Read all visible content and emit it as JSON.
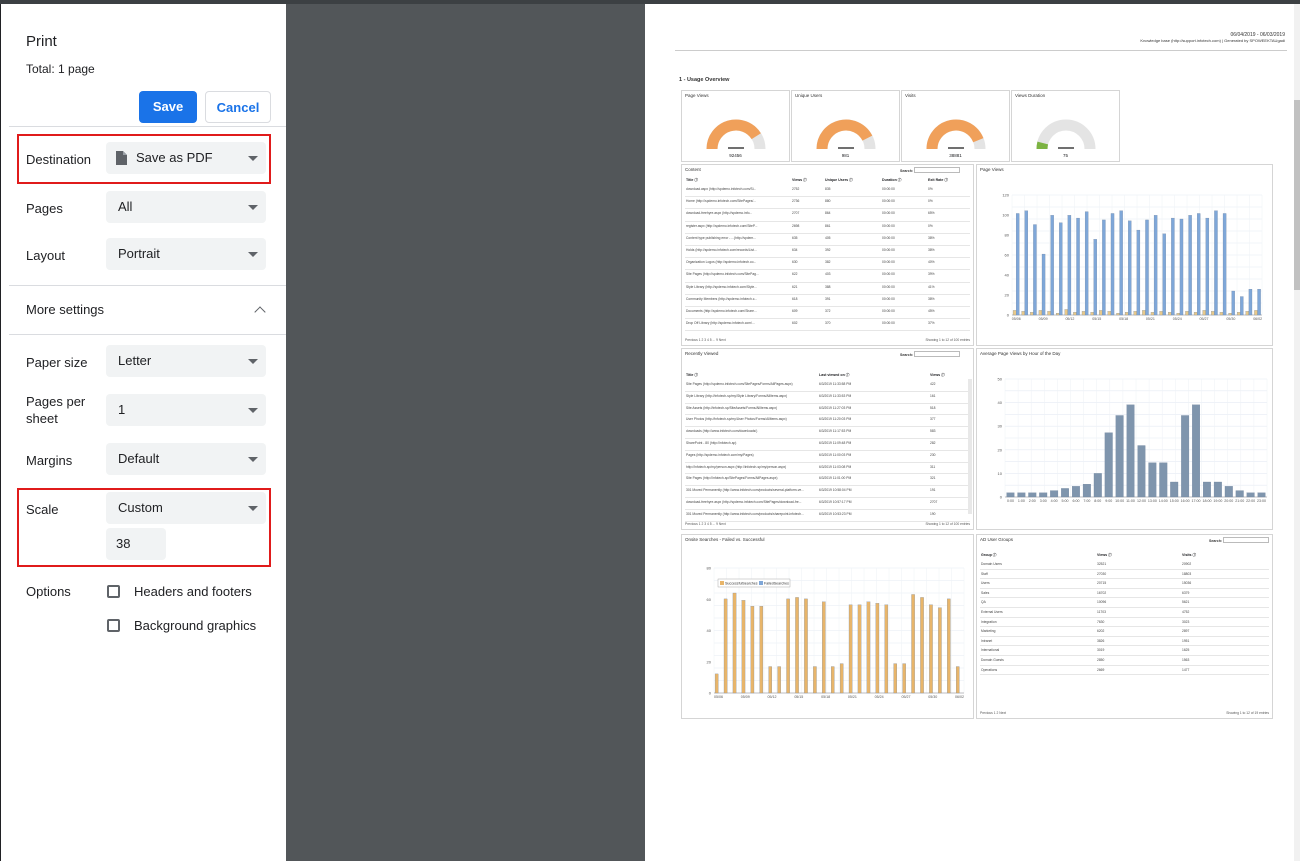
{
  "dialog": {
    "title": "Print",
    "total": "Total: 1 page",
    "save_label": "Save",
    "cancel_label": "Cancel"
  },
  "settings": {
    "destination": {
      "label": "Destination",
      "value": "Save as PDF"
    },
    "pages": {
      "label": "Pages",
      "value": "All"
    },
    "layout": {
      "label": "Layout",
      "value": "Portrait"
    },
    "more_settings": "More settings",
    "paper_size": {
      "label": "Paper size",
      "value": "Letter"
    },
    "pages_per_sheet": {
      "label": "Pages per sheet",
      "value": "1"
    },
    "margins": {
      "label": "Margins",
      "value": "Default"
    },
    "scale": {
      "label": "Scale",
      "value": "Custom",
      "custom_value": "38"
    },
    "options": {
      "label": "Options",
      "headers_footers": {
        "label": "Headers and footers",
        "checked": false
      },
      "background_graphics": {
        "label": "Background graphics",
        "checked": false
      }
    }
  },
  "preview": {
    "header_right_1": "06/04/2019 - 06/03/2019",
    "header_right_2": "Knowledge base (http://support.infotech.com) | Generated by SPOWEEKTAUgadi",
    "section_title": "1 - Usage Overview",
    "gauges": [
      {
        "title": "Page Views",
        "value": "92456",
        "level": 0.82
      },
      {
        "title": "Unique Users",
        "value": "981",
        "level": 0.85
      },
      {
        "title": "Visits",
        "value": "38881",
        "level": 0.88
      },
      {
        "title": "Views Duration",
        "value": "75",
        "level": 0.08
      }
    ],
    "content_panel": {
      "title": "Content",
      "search_label": "Search:",
      "columns": [
        "Title",
        "Views",
        "Unique Users",
        "Duration",
        "Exit Rate"
      ],
      "rows": [
        [
          "download.aspx (http://spdemo.infotech.com/Si...",
          "2752",
          "835",
          "00:00:00",
          "0%"
        ],
        [
          "Home (http://spdemo.infotech.com/SitePages/...",
          "2736",
          "880",
          "00:00:00",
          "0%"
        ],
        [
          "download-freehyre.aspx (http://spdemo.info...",
          "2707",
          "864",
          "00:00:00",
          "65%"
        ],
        [
          "register.aspx (http://spdemo.infotech.com/SiteP...",
          "2698",
          "861",
          "00:00:00",
          "0%"
        ],
        [
          "Content type publishing error - ...(http://spdem...",
          "635",
          "405",
          "00:00:00",
          "38%"
        ],
        [
          "Holds (http://spdemo.infotech.com/records/List...",
          "634",
          "392",
          "00:00:00",
          "38%"
        ],
        [
          "Organization Logos (http://spdemo.infotech.co...",
          "630",
          "382",
          "00:00:00",
          "40%"
        ],
        [
          "Site Pages (http://spdemo.infotech.com/SitePag...",
          "622",
          "403",
          "00:00:00",
          "39%"
        ],
        [
          "Style Library (http://spdemo.infotech.com/Style...",
          "621",
          "388",
          "00:00:00",
          "41%"
        ],
        [
          "Community Members (http://spdemo.infotech.c...",
          "618",
          "391",
          "00:00:00",
          "38%"
        ],
        [
          "Documents (http://spdemo.infotech.com/Share...",
          "609",
          "372",
          "00:00:00",
          "45%"
        ],
        [
          "Drop Off Library (http://spdemo.infotech.com/...",
          "602",
          "370",
          "00:00:00",
          "37%"
        ]
      ],
      "pager": "Previous  1  2  3  4  5 ... 9  Next",
      "showing": "Showing 1 to 12 of 100 entries"
    },
    "pageviews_chart": {
      "title": "Page Views",
      "yticks": [
        "120",
        "100",
        "80",
        "60",
        "40",
        "20",
        "0"
      ],
      "xticks": [
        "05/06",
        "05/09",
        "05/12",
        "05/15",
        "05/18",
        "05/21",
        "05/24",
        "05/27",
        "05/30",
        "06/02"
      ]
    },
    "recent_panel": {
      "title": "Recently Viewed",
      "search_label": "Search:",
      "columns": [
        "Title",
        "Last viewed on",
        "Views"
      ],
      "rows": [
        [
          "Site Pages (http://spdemo.infotech.com/SitePages/Forms/AllPages.aspx)",
          "6/3/2019 11:33:58 PM",
          "422"
        ],
        [
          "Style Library (http://infotech-sp/my/Style Library/Forms/AllItems.aspx)",
          "6/3/2019 11:33:53 PM",
          "161"
        ],
        [
          "Site Assets (http://infotech-sp/SiteAssets/Forms/AllItems.aspx)",
          "6/3/2019 11:27:03 PM",
          "518"
        ],
        [
          "User Photos (http://infotech-sp/my/User Photos/Forms/AllItems.aspx)",
          "6/3/2019 11:20:03 PM",
          "377"
        ],
        [
          "downloads (http://www.infotech.com/downloads/)",
          "6/3/2019 11:17:53 PM",
          "583"
        ],
        [
          "SharePoint - 80 (http://infotech-sp)",
          "6/3/2019 11:09:48 PM",
          "282"
        ],
        [
          "Pages (http://spdemo.infotech.com/my/Pages)",
          "6/3/2019 11:00:03 PM",
          "230"
        ],
        [
          "http://infotech-sp/my/person.aspx (http://infotech-sp/my/person.aspx)",
          "6/3/2019 11:03:08 PM",
          "311"
        ],
        [
          "Site Pages (http://infotech-sp/SitePages/Forms/AllPages.aspx)",
          "6/3/2019 11:01:00 PM",
          "321"
        ],
        [
          "301 Moved Permanently (http://www.infotech.com/products/several-platform-ve...",
          "6/3/2019 10:58:04 PM",
          "191"
        ],
        [
          "download-freehyre.aspx (http://spdemo.infotech.com/SitePages/download-fre...",
          "6/3/2019 10:57:17 PM",
          "2707"
        ],
        [
          "301 Moved Permanently (http://www.infotech.com/products/sharepoint-infotech...",
          "6/3/2019 10:53:23 PM",
          "190"
        ]
      ],
      "pager": "Previous  1  2  3  4  5 ... 9  Next",
      "showing": "Showing 1 to 12 of 100 entries"
    },
    "hourly_chart": {
      "title": "Average Page Views by Hour of the Day",
      "yticks": [
        "50",
        "40",
        "30",
        "20",
        "10",
        "0"
      ],
      "xticks": [
        "0:00",
        "1:00",
        "2:00",
        "3:00",
        "4:00",
        "5:00",
        "6:00",
        "7:00",
        "8:00",
        "9:00",
        "10:00",
        "11:00",
        "12:00",
        "13:00",
        "14:00",
        "15:00",
        "16:00",
        "17:00",
        "18:00",
        "19:00",
        "20:00",
        "21:00",
        "22:00",
        "23:00"
      ]
    },
    "onsite_chart": {
      "title": "Onsite Searches - Failed vs. Successful",
      "legend": [
        "SuccessfulSearches",
        "FailedSearches"
      ],
      "yticks": [
        "80",
        "60",
        "40",
        "20",
        "0"
      ],
      "xticks": [
        "05/06",
        "05/09",
        "05/12",
        "05/15",
        "05/18",
        "05/21",
        "05/24",
        "05/27",
        "05/30",
        "06/02"
      ]
    },
    "groups_panel": {
      "title": "AD User Groups",
      "search_label": "Search:",
      "columns": [
        "Group",
        "Views",
        "Visits"
      ],
      "rows": [
        [
          "Domain Users",
          "32521",
          "20902"
        ],
        [
          "Staff",
          "27030",
          "18803"
        ],
        [
          "Users",
          "20715",
          "15036"
        ],
        [
          "Sales",
          "16702",
          "6379"
        ],
        [
          "QA",
          "10096",
          "5621"
        ],
        [
          "External Users",
          "11703",
          "4752"
        ],
        [
          "Integration",
          "7630",
          "3023"
        ],
        [
          "Marketing",
          "6202",
          "2897"
        ],
        [
          "Intranet",
          "3826",
          "1951"
        ],
        [
          "International",
          "3019",
          "1625"
        ],
        [
          "Domain Guests",
          "2850",
          "1563"
        ],
        [
          "Operations",
          "2669",
          "1477"
        ]
      ],
      "pager": "Previous  1  2  Next",
      "showing": "Showing 1 to 12 of 19 entries"
    }
  },
  "chart_data": [
    {
      "type": "bar",
      "title": "Page Views",
      "categories": [
        "05/06",
        "05/07",
        "05/08",
        "05/09",
        "05/10",
        "05/11",
        "05/12",
        "05/13",
        "05/14",
        "05/15",
        "05/16",
        "05/17",
        "05/18",
        "05/19",
        "05/20",
        "05/21",
        "05/22",
        "05/23",
        "05/24",
        "05/25",
        "05/26",
        "05/27",
        "05/28",
        "05/29",
        "05/30",
        "05/31",
        "06/01",
        "06/02",
        "06/03"
      ],
      "series": [
        {
          "name": "",
          "values": [
            5,
            4,
            3,
            5,
            4,
            2,
            6,
            3,
            4,
            3,
            5,
            4,
            2,
            3,
            4,
            5,
            3,
            4,
            3,
            2,
            4,
            3,
            5,
            4,
            3,
            2,
            3,
            4,
            5
          ]
        },
        {
          "name": "",
          "values": [
            110,
            113,
            98,
            66,
            108,
            100,
            108,
            105,
            112,
            82,
            103,
            110,
            113,
            102,
            92,
            103,
            108,
            88,
            105,
            104,
            108,
            110,
            105,
            113,
            110,
            26,
            20,
            28,
            28
          ]
        }
      ],
      "ylim": [
        0,
        130
      ]
    },
    {
      "type": "bar",
      "title": "Average Page Views by Hour of the Day",
      "categories": [
        "0:00",
        "1:00",
        "2:00",
        "3:00",
        "4:00",
        "5:00",
        "6:00",
        "7:00",
        "8:00",
        "9:00",
        "10:00",
        "11:00",
        "12:00",
        "13:00",
        "14:00",
        "15:00",
        "16:00",
        "17:00",
        "18:00",
        "19:00",
        "20:00",
        "21:00",
        "22:00",
        "23:00"
      ],
      "values": [
        2,
        2,
        2,
        2,
        3,
        4,
        5,
        6,
        11,
        30,
        38,
        43,
        24,
        16,
        16,
        7,
        38,
        43,
        7,
        7,
        5,
        3,
        2,
        2
      ],
      "ylim": [
        0,
        55
      ]
    },
    {
      "type": "bar",
      "title": "Onsite Searches - Failed vs. Successful",
      "categories": [
        "05/06",
        "05/07",
        "05/08",
        "05/09",
        "05/10",
        "05/11",
        "05/12",
        "05/13",
        "05/14",
        "05/15",
        "05/16",
        "05/17",
        "05/18",
        "05/19",
        "05/20",
        "05/21",
        "05/22",
        "05/23",
        "05/24",
        "05/25",
        "05/26",
        "05/27",
        "05/28",
        "05/29",
        "05/30",
        "05/31",
        "06/01",
        "06/02"
      ],
      "series": [
        {
          "name": "SuccessfulSearches",
          "values": [
            13,
            64,
            68,
            63,
            59,
            59,
            18,
            18,
            64,
            65,
            64,
            18,
            62,
            18,
            20,
            60,
            60,
            62,
            61,
            60,
            20,
            20,
            67,
            65,
            60,
            58,
            64,
            18
          ]
        },
        {
          "name": "FailedSearches",
          "values": [
            0,
            0,
            0,
            0,
            0,
            0,
            0,
            0,
            0,
            0,
            0,
            0,
            0,
            0,
            0,
            0,
            0,
            0,
            0,
            0,
            0,
            0,
            0,
            0,
            0,
            0,
            0,
            0
          ]
        }
      ],
      "ylim": [
        0,
        85
      ]
    }
  ]
}
